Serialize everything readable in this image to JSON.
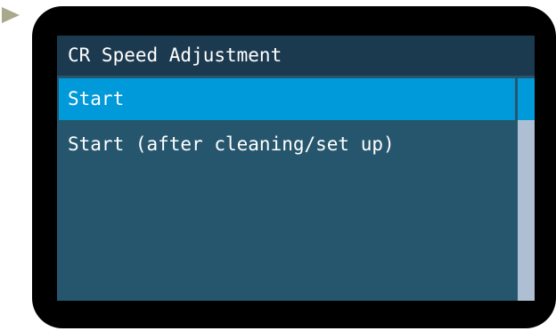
{
  "screen": {
    "title": "CR Speed Adjustment",
    "items": [
      {
        "label": "Start",
        "selected": true
      },
      {
        "label": "Start (after cleaning/set up)",
        "selected": false
      }
    ],
    "scroll_position": 0
  },
  "colors": {
    "bezel": "#000000",
    "screen_bg": "#26566d",
    "title_bar": "#1c3a4f",
    "selection": "#0099d9",
    "scroll_track": "#aebfd3",
    "pointer": "#a9a88a"
  }
}
